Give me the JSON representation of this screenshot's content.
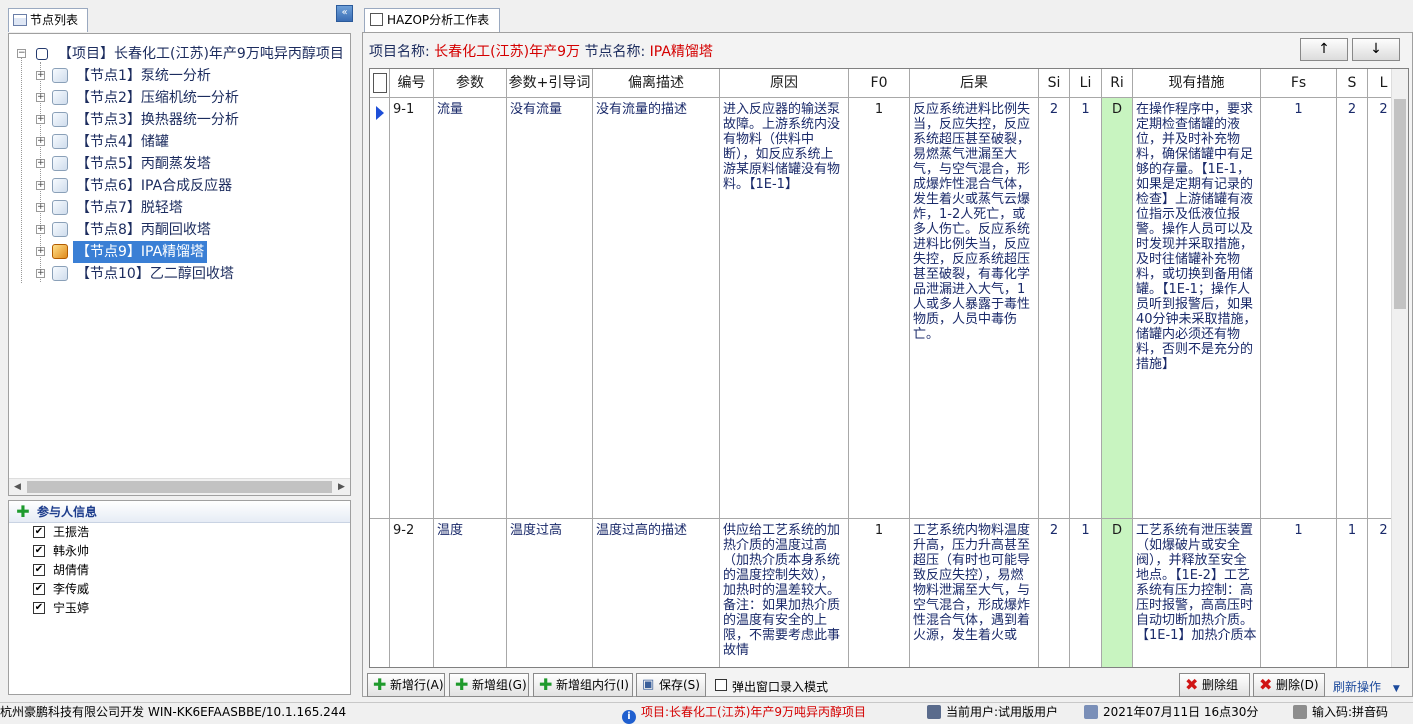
{
  "left_panel": {
    "tab_title": "节点列表",
    "tree": {
      "root_label": "【项目】长春化工(江苏)年产9万吨异丙醇项目",
      "nodes": [
        {
          "label": "【节点1】泵统一分析",
          "selected": false
        },
        {
          "label": "【节点2】压缩机统一分析",
          "selected": false
        },
        {
          "label": "【节点3】换热器统一分析",
          "selected": false
        },
        {
          "label": "【节点4】储罐",
          "selected": false
        },
        {
          "label": "【节点5】丙酮蒸发塔",
          "selected": false
        },
        {
          "label": "【节点6】IPA合成反应器",
          "selected": false
        },
        {
          "label": "【节点7】脱轻塔",
          "selected": false
        },
        {
          "label": "【节点8】丙酮回收塔",
          "selected": false
        },
        {
          "label": "【节点9】IPA精馏塔",
          "selected": true
        },
        {
          "label": "【节点10】乙二醇回收塔",
          "selected": false
        }
      ]
    },
    "participants": {
      "title": "参与人信息",
      "people": [
        {
          "name": "王振浩",
          "checked": true
        },
        {
          "name": "韩永帅",
          "checked": true
        },
        {
          "name": "胡倩倩",
          "checked": true
        },
        {
          "name": "李传威",
          "checked": true
        },
        {
          "name": "宁玉婷",
          "checked": true
        }
      ]
    }
  },
  "work": {
    "tab_title": "HAZOP分析工作表",
    "project_label": "项目名称:",
    "project_value": "长春化工(江苏)年产9万",
    "node_label": "节点名称:",
    "node_value": "IPA精馏塔",
    "nav_up": "↑",
    "nav_down": "↓",
    "columns": [
      "编号",
      "参数",
      "参数+引导词",
      "偏离描述",
      "原因",
      "F0",
      "后果",
      "Si",
      "Li",
      "Ri",
      "现有措施",
      "Fs",
      "S",
      "L"
    ],
    "rows": [
      {
        "id": "9-1",
        "param": "流量",
        "guide": "没有流量",
        "deviation": "没有流量的描述",
        "cause": "进入反应器的输送泵故障。上游系统内没有物料（供料中断），如反应系统上游某原料储罐没有物料。【1E-1】",
        "f0": "1",
        "consequence": "反应系统进料比例失当，反应失控，反应系统超压甚至破裂，易燃蒸气泄漏至大气，与空气混合，形成爆炸性混合气体，发生着火或蒸气云爆炸，1-2人死亡，或多人伤亡。反应系统进料比例失当，反应失控，反应系统超压甚至破裂，有毒化学品泄漏进入大气，1人或多人暴露于毒性物质，人员中毒伤亡。",
        "si": "2",
        "li": "1",
        "ri": "D",
        "measures": "在操作程序中，要求定期检查储罐的液位，并及时补充物料，确保储罐中有足够的存量。【1E-1，如果是定期有记录的检查】上游储罐有液位指示及低液位报警。操作人员可以及时发现并采取措施，及时往储罐补充物料，或切换到备用储罐。【1E-1；操作人员听到报警后，如果40分钟未采取措施，储罐内必须还有物料，否则不是充分的措施】",
        "fs": "1",
        "s": "2",
        "l": "2"
      },
      {
        "id": "9-2",
        "param": "温度",
        "guide": "温度过高",
        "deviation": "温度过高的描述",
        "cause": "供应给工艺系统的加热介质的温度过高（加热介质本身系统的温度控制失效），加热时的温差较大。备注：如果加热介质的温度有安全的上限，不需要考虑此事故情",
        "f0": "1",
        "consequence": "工艺系统内物料温度升高，压力升高甚至超压（有时也可能导致反应失控），易燃物料泄漏至大气，与空气混合，形成爆炸性混合气体，遇到着火源，发生着火或",
        "si": "2",
        "li": "1",
        "ri": "D",
        "measures": "工艺系统有泄压装置（如爆破片或安全阀），并释放至安全地点。【1E-2】工艺系统有压力控制：高压时报警，高高压时自动切断加热介质。【1E-1】加热介质本",
        "fs": "1",
        "s": "1",
        "l": "2"
      }
    ],
    "buttons": {
      "add_row": "新增行(A)",
      "add_group": "新增组(G)",
      "add_in_group": "新增组内行(I)",
      "save": "保存(S)",
      "popup_mode": "弹出窗口录入模式",
      "delete_group": "删除组",
      "delete": "删除(D)",
      "refresh": "刷新操作"
    },
    "popup_mode_checked": false
  },
  "status": {
    "developer": "杭州豪鹏科技有限公司开发",
    "machine": "WIN-KK6EFAASBBE/10.1.165.244",
    "project": "项目:长春化工(江苏)年产9万吨异丙醇项目",
    "user": "当前用户:试用版用户",
    "datetime": "2021年07月11日 16点30分",
    "input_method": "输入码:拼音码"
  }
}
